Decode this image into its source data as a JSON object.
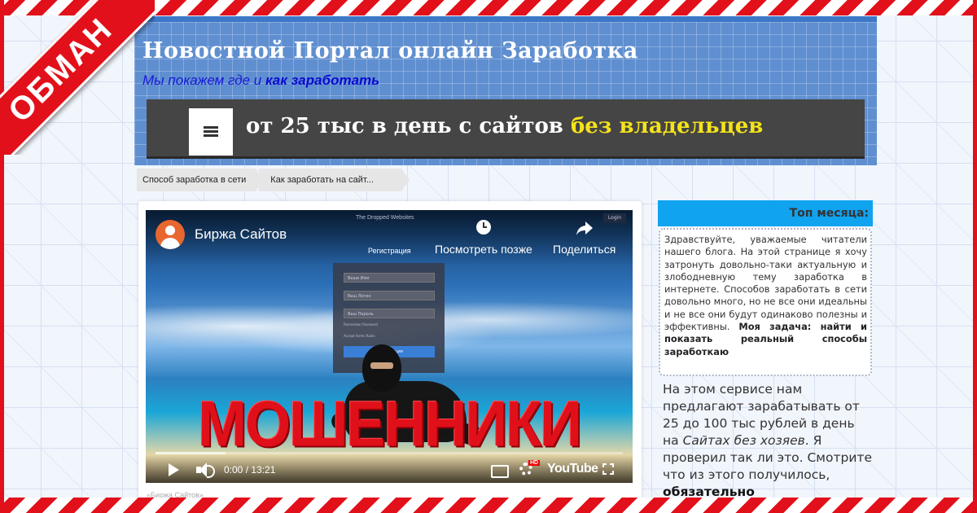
{
  "ribbon": {
    "text": "ОБМАН"
  },
  "header": {
    "title": "Новостной Портал онлайн Заработка",
    "tagline_part1": "Мы покажем где и",
    "tagline_part2": "как заработать",
    "menu_headline_part1": "от 25 тыс в день с сайтов",
    "menu_headline_part2": "без владельцев"
  },
  "breadcrumb": [
    {
      "label": "Способ заработка в сети"
    },
    {
      "label": "Как заработать на сайт..."
    }
  ],
  "video": {
    "channel_name": "Биржа Сайтов",
    "site_title": "The Dropped Websites",
    "mini_button": "Login",
    "watch_later": "Посмотреть позже",
    "share": "Поделиться",
    "registration": "Регистрация",
    "form_fields": [
      "Ваше Имя",
      "Ваш Логин",
      "Ваш Пароль"
    ],
    "form_small_1": "Remember Password",
    "form_small_2": "Accept terms Rules",
    "form_submit": "Регистрация",
    "overlay_text": "МОШЕННИКИ",
    "time": "0:00 / 13:21",
    "hd_badge": "HD",
    "logo": "YouTube",
    "progress_played": 0.0,
    "caption_stub": "«Биржа Сайтов»"
  },
  "sidebar": {
    "header": "Топ месяца:",
    "intro_text": "Здравствуйте, уважаемые читатели нашего блога. На этой странице я хочу затронуть довольно-таки актуальную и злободневную тему заработка в интернете. Способов заработать в сети довольно много, но не все они идеальны и не все они будут одинаково полезны и эффективны.",
    "intro_bold": "Моя задача: найти и показать реальный способы заработкаю",
    "text_part1": "На этом сервисе нам предлагают зарабатывать от 25 до 100 тыс рублей в день на",
    "text_italic": "Сайтах без хозяев",
    "text_part2": ". Я проверил так ли это. Смотрите что из этого получилось,",
    "text_bold": "обязательно"
  },
  "colors": {
    "hazard_red": "#e2101a",
    "header_blue": "#5f8fd0",
    "menu_dark": "#454545",
    "headline_yellow": "#f5e31a",
    "sidebar_accent": "#0fa3f0"
  }
}
